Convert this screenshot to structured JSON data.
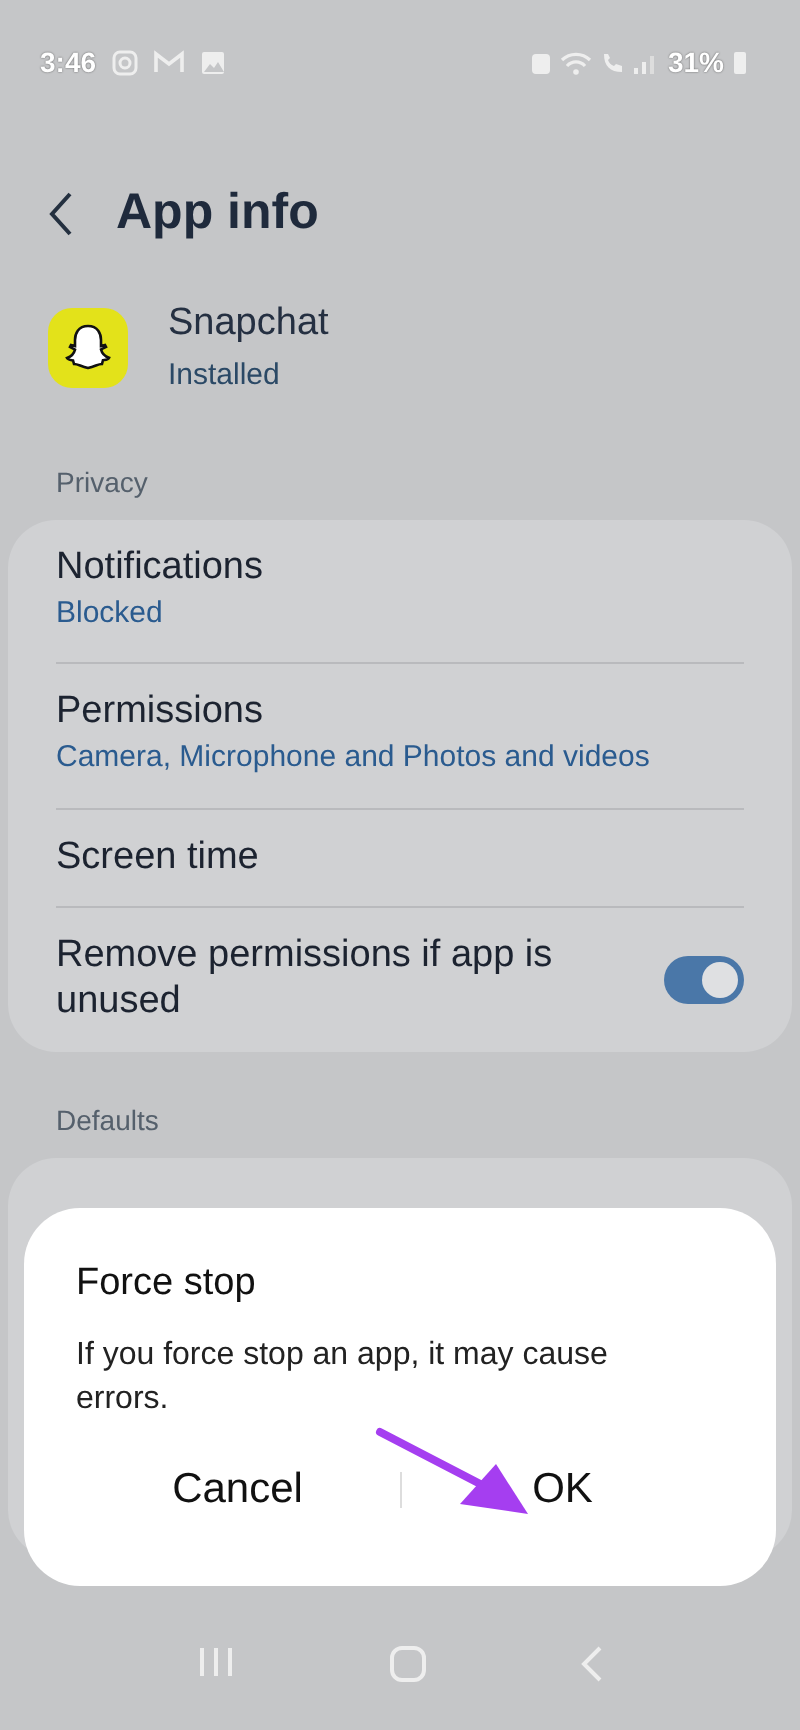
{
  "status_bar": {
    "time": "3:46",
    "battery": "31%"
  },
  "header": {
    "title": "App info"
  },
  "app": {
    "name": "Snapchat",
    "status": "Installed"
  },
  "sections": [
    {
      "label": "Privacy",
      "items": [
        {
          "kind": "info",
          "title": "Notifications",
          "subtitle": "Blocked"
        },
        {
          "kind": "info",
          "title": "Permissions",
          "subtitle": "Camera, Microphone and Photos and videos"
        },
        {
          "kind": "info",
          "title": "Screen time"
        },
        {
          "kind": "toggle",
          "title": "Remove permissions if app is unused",
          "on": true
        }
      ]
    },
    {
      "label": "Defaults"
    }
  ],
  "dialog": {
    "title": "Force stop",
    "message": "If you force stop an app, it may cause errors.",
    "buttons": [
      "Cancel",
      "OK"
    ]
  }
}
